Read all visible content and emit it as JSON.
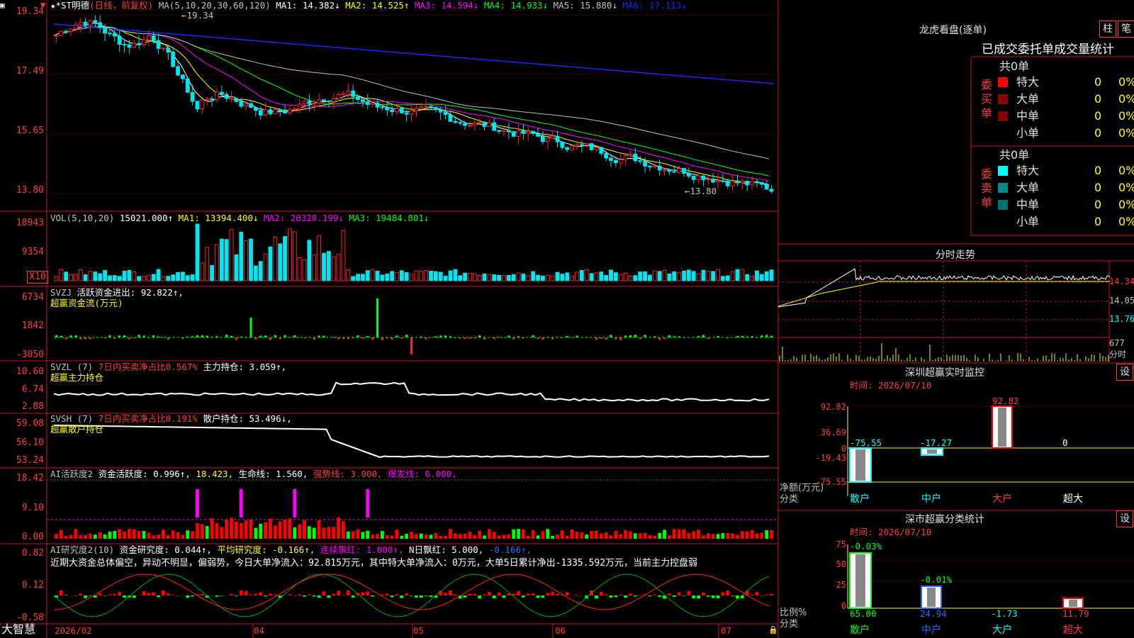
{
  "app": {
    "title": "大智慧"
  },
  "main": {
    "stock_name": "★*ST明德",
    "period": "(日线，前复权)",
    "ma_header": "MA(5,10,20,30,60,120)",
    "ma1": "MA1: 14.382↓",
    "ma2": "MA2: 14.525↑",
    "ma3": "MA3: 14.594↓",
    "ma4": "MA4: 14.933↓",
    "ma5": "MA5: 15.880↓",
    "ma6": "MA6: 17.113↓",
    "high_mark": "←19.34",
    "low_mark": "←13.80",
    "y_labels": [
      "19.34",
      "17.49",
      "15.65",
      "13.80"
    ],
    "colors": {
      "up": "#ff2020",
      "down": "#00e5ee",
      "ma1": "#ffffff",
      "ma2": "#ffff00",
      "ma3": "#ff00ff",
      "ma4": "#00ff00",
      "ma5": "#c0c0c0",
      "ma6": "#2222ff"
    }
  },
  "vol": {
    "header": "VOL(5,10,20)",
    "value": "15021.000↑",
    "ma1": "MA1: 13394.400↓",
    "ma2": "MA2: 20328.199↓",
    "ma3": "MA3: 19484.801↓",
    "y_labels": [
      "18943",
      "9354"
    ],
    "unit": "X10"
  },
  "svzj": {
    "header": "SVZJ",
    "line1": "活跃资金进出: 92.822↑,",
    "line2": "超赢资金流(万元)",
    "y_labels": [
      "6734",
      "1842",
      "-3050"
    ]
  },
  "svzl": {
    "header": "SVZL (7)",
    "ratio": "7日内买卖净占比0.567%",
    "hold": "主力持仓: 3.059↑,",
    "line2": "超赢主力持仓",
    "y_labels": [
      "10.60",
      "6.74",
      "2.88"
    ]
  },
  "svsh": {
    "header": "SVSH (7)",
    "ratio": "7日内买卖净占比0.191%",
    "hold": "散户持仓: 53.496↓,",
    "line2": "超赢散户持仓",
    "y_labels": [
      "59.08",
      "56.10",
      "53.24"
    ]
  },
  "ai_active": {
    "header": "AI活跃度2",
    "activity": "资金活跃度: 0.996↑,",
    "v2": "18.423,",
    "life": "生命线: 1.560,",
    "strong": "强势线: 3.000,",
    "burst": "爆发线: 6.000,",
    "y_labels": [
      "18.42",
      "9.10",
      "0.00"
    ]
  },
  "ai_research": {
    "header": "AI研究度2(10)",
    "research": "资金研究度: 0.044↑,",
    "avg": "平均研究度: -0.166↑,",
    "cont": "连续飘红: 1.000↑,",
    "nday": "N日飘红: 5.000,",
    "last": "-0.166↑,",
    "comment": "近期大资金总体偏空，异动不明显，偏弱势，今日大单净流入：92.815万元，其中特大单净流入：0万元，大单5日累计净出-1335.592万元，当前主力控盘弱",
    "y_labels": [
      "0.82",
      "0.12",
      "-0.58"
    ]
  },
  "x_axis": {
    "labels": [
      "2026/02",
      "04",
      "05",
      "06",
      "07"
    ]
  },
  "right": {
    "dragon_title": "龙虎看盘(逐单)",
    "btn_zhu": "柱",
    "btn_bi": "笔",
    "stats_title": "已成交委托单成交量统计",
    "buy": {
      "label": "委买单",
      "total": "共0单",
      "rows": [
        {
          "name": "特大",
          "v1": "0",
          "v2": "0%",
          "color": "#ff0000"
        },
        {
          "name": "大单",
          "v1": "0",
          "v2": "0%",
          "color": "#8b0000"
        },
        {
          "name": "中单",
          "v1": "0",
          "v2": "0%",
          "color": "#800000"
        },
        {
          "name": "小单",
          "v1": "0",
          "v2": "0%",
          "color": "#000000"
        }
      ]
    },
    "sell": {
      "label": "委卖单",
      "total": "共0单",
      "rows": [
        {
          "name": "特大",
          "v1": "0",
          "v2": "0%",
          "color": "#00ffff"
        },
        {
          "name": "大单",
          "v1": "0",
          "v2": "0%",
          "color": "#008b8b"
        },
        {
          "name": "中单",
          "v1": "0",
          "v2": "0%",
          "color": "#007070"
        },
        {
          "name": "小单",
          "v1": "0",
          "v2": "0%",
          "color": "#000000"
        }
      ]
    },
    "intraday_title": "分时走势",
    "intraday_labels": [
      "14.34",
      "14.05",
      "13.76",
      "677",
      "分时"
    ],
    "sz_monitor": {
      "title": "深圳超赢实时监控",
      "btn": "设",
      "time": "时间: 2026/07/10",
      "y_labels": [
        "92.82",
        "36.69",
        "0",
        "-19.43",
        "-75.55"
      ],
      "values": [
        "-75.55",
        "-17.27",
        "92.82",
        "0"
      ],
      "cats": [
        "散户",
        "中户",
        "大户",
        "超大"
      ],
      "ylabel": "净额(万元)",
      "xlabel": "分类"
    },
    "sz_class": {
      "title": "深市超赢分类统计",
      "btn": "设",
      "time": "时间: 2026/07/10",
      "y_labels": [
        "75",
        "50",
        "25",
        "0"
      ],
      "top_values": [
        "-0.03%",
        "-0.01%"
      ],
      "values": [
        "65.00",
        "24.94",
        "-1.73",
        "11.79"
      ],
      "cats": [
        "散户",
        "中户",
        "大户",
        "超大"
      ],
      "ylabel": "比例%",
      "xlabel": "分类"
    }
  }
}
